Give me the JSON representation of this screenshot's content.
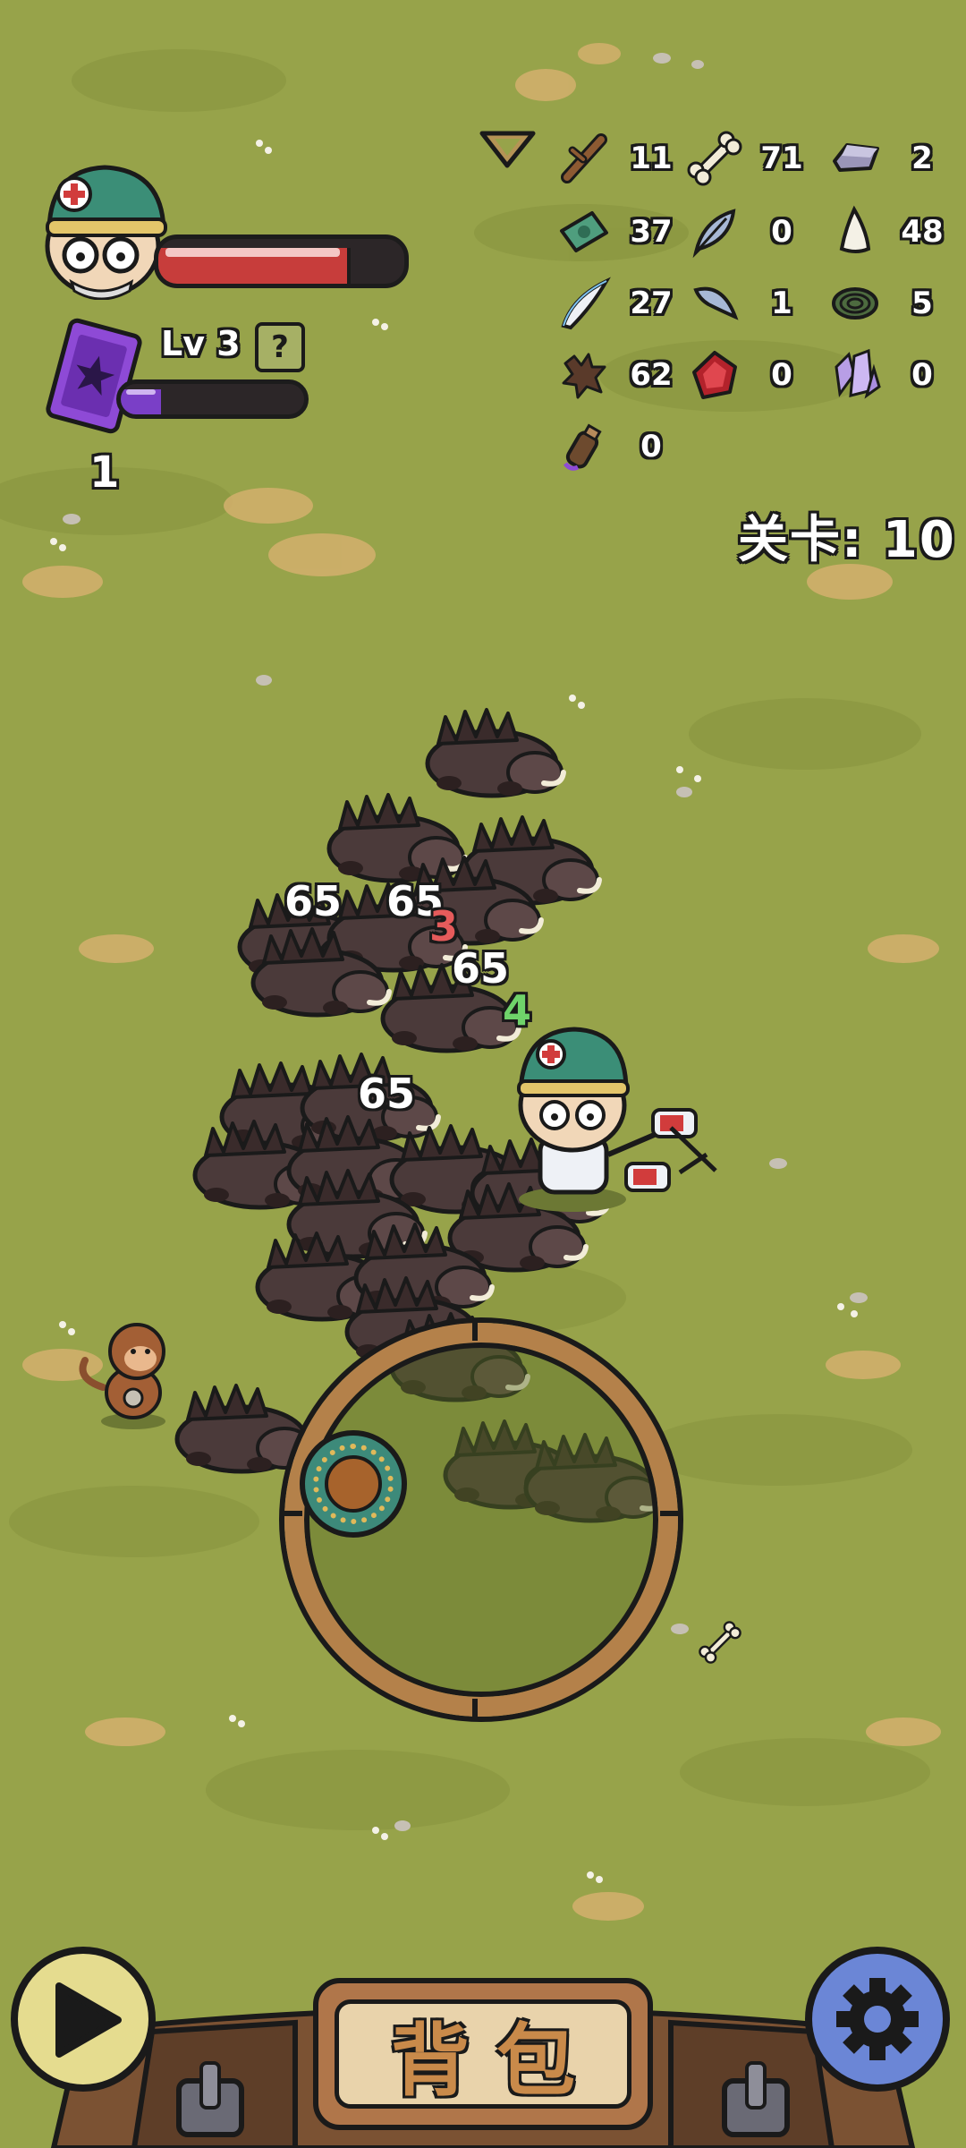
{
  "player": {
    "health_fraction": 0.78,
    "xp_fraction": 0.22
  },
  "level": {
    "label": "Lv 3",
    "help": "?"
  },
  "card_count": "1",
  "stage": {
    "label": "关卡: 10"
  },
  "resources": [
    {
      "icon": "stick-icon",
      "count": "11"
    },
    {
      "icon": "bone-icon",
      "count": "71"
    },
    {
      "icon": "iron-ingot-icon",
      "count": "2"
    },
    {
      "icon": "cash-icon",
      "count": "37"
    },
    {
      "icon": "feather-icon",
      "count": "0"
    },
    {
      "icon": "tooth-icon",
      "count": "48"
    },
    {
      "icon": "fang-icon",
      "count": "27"
    },
    {
      "icon": "claw-icon",
      "count": "1"
    },
    {
      "icon": "rope-icon",
      "count": "5"
    },
    {
      "icon": "hide-icon",
      "count": "62"
    },
    {
      "icon": "ruby-icon",
      "count": "0"
    },
    {
      "icon": "crystal-icon",
      "count": "0"
    },
    {
      "icon": "potion-icon",
      "count": "0"
    }
  ],
  "damage_numbers": [
    "65",
    "65",
    "3",
    "65",
    "4",
    "65"
  ],
  "bottom_bar": {
    "backpack_label": "背包"
  },
  "colors": {
    "grass": "#97a34a",
    "health": "#c73d3b",
    "xp": "#7a3fc7",
    "damage_crit": "#e55b5b",
    "heal": "#6fd36a"
  }
}
